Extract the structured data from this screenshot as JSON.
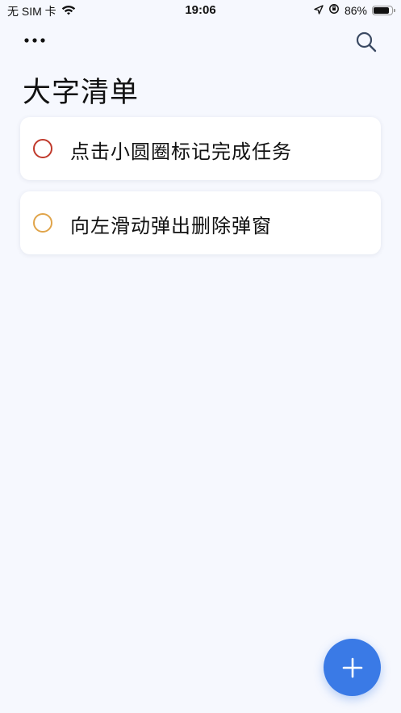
{
  "status_bar": {
    "carrier": "无 SIM 卡",
    "time": "19:06",
    "battery": "86%",
    "battery_level": 0.86
  },
  "header": {
    "more_icon": "ellipsis-icon",
    "search_icon": "search-icon",
    "title": "大字清单"
  },
  "tasks": [
    {
      "text": "点击小圆圈标记完成任务",
      "circle_color": "#c0392b"
    },
    {
      "text": "向左滑动弹出删除弹窗",
      "circle_color": "#e0a44a"
    }
  ],
  "fab": {
    "icon": "plus-icon",
    "color": "#3a7ae6"
  }
}
